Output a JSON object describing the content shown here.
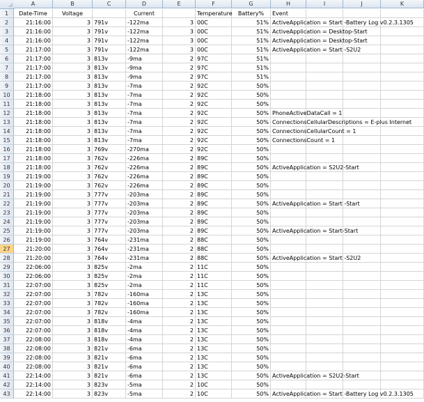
{
  "columns": [
    "A",
    "B",
    "C",
    "D",
    "E",
    "F",
    "G",
    "H",
    "I",
    "J",
    "K"
  ],
  "header": {
    "A": "Date-Time",
    "B": "Voltage",
    "D": "Current",
    "F": "Temperature",
    "G": "Battery%",
    "H": "Event"
  },
  "rows": [
    {
      "A": "21:16:00",
      "B": "3",
      "C": "791v",
      "D": "-122ma",
      "E": "3",
      "F": "00C",
      "G": "51%",
      "H": "ActiveApplication = Start   -Battery Log v0.2.3.1305"
    },
    {
      "A": "21:16:00",
      "B": "3",
      "C": "791v",
      "D": "-122ma",
      "E": "3",
      "F": "00C",
      "G": "51%",
      "H": "ActiveApplication = Desktop-Start"
    },
    {
      "A": "21:16:00",
      "B": "3",
      "C": "791v",
      "D": "-122ma",
      "E": "3",
      "F": "00C",
      "G": "51%",
      "H": "ActiveApplication = Desktop-Start"
    },
    {
      "A": "21:17:00",
      "B": "3",
      "C": "791v",
      "D": "-122ma",
      "E": "3",
      "F": "00C",
      "G": "51%",
      "H": "ActiveApplication = Start   -S2U2"
    },
    {
      "A": "21:17:00",
      "B": "3",
      "C": "813v",
      "D": "-9ma",
      "E": "2",
      "F": "97C",
      "G": "51%",
      "H": ""
    },
    {
      "A": "21:17:00",
      "B": "3",
      "C": "813v",
      "D": "-9ma",
      "E": "2",
      "F": "97C",
      "G": "51%",
      "H": ""
    },
    {
      "A": "21:17:00",
      "B": "3",
      "C": "813v",
      "D": "-9ma",
      "E": "2",
      "F": "97C",
      "G": "51%",
      "H": ""
    },
    {
      "A": "21:17:00",
      "B": "3",
      "C": "813v",
      "D": "-7ma",
      "E": "2",
      "F": "92C",
      "G": "50%",
      "H": ""
    },
    {
      "A": "21:18:00",
      "B": "3",
      "C": "813v",
      "D": "-7ma",
      "E": "2",
      "F": "92C",
      "G": "50%",
      "H": ""
    },
    {
      "A": "21:18:00",
      "B": "3",
      "C": "813v",
      "D": "-7ma",
      "E": "2",
      "F": "92C",
      "G": "50%",
      "H": ""
    },
    {
      "A": "21:18:00",
      "B": "3",
      "C": "813v",
      "D": "-7ma",
      "E": "2",
      "F": "92C",
      "G": "50%",
      "H": "PhoneActiveDataCall = 1"
    },
    {
      "A": "21:18:00",
      "B": "3",
      "C": "813v",
      "D": "-7ma",
      "E": "2",
      "F": "92C",
      "G": "50%",
      "H": "ConnectionsCellularDescriptions = E-plus Internet"
    },
    {
      "A": "21:18:00",
      "B": "3",
      "C": "813v",
      "D": "-7ma",
      "E": "2",
      "F": "92C",
      "G": "50%",
      "H": "ConnectionsCellularCount = 1"
    },
    {
      "A": "21:18:00",
      "B": "3",
      "C": "813v",
      "D": "-7ma",
      "E": "2",
      "F": "92C",
      "G": "50%",
      "H": "ConnectionsCount = 1"
    },
    {
      "A": "21:18:00",
      "B": "3",
      "C": "769v",
      "D": "-270ma",
      "E": "2",
      "F": "92C",
      "G": "50%",
      "H": ""
    },
    {
      "A": "21:18:00",
      "B": "3",
      "C": "762v",
      "D": "-226ma",
      "E": "2",
      "F": "89C",
      "G": "50%",
      "H": ""
    },
    {
      "A": "21:18:00",
      "B": "3",
      "C": "762v",
      "D": "-226ma",
      "E": "2",
      "F": "89C",
      "G": "50%",
      "H": "ActiveApplication = S2U2-Start"
    },
    {
      "A": "21:19:00",
      "B": "3",
      "C": "762v",
      "D": "-226ma",
      "E": "2",
      "F": "89C",
      "G": "50%",
      "H": ""
    },
    {
      "A": "21:19:00",
      "B": "3",
      "C": "762v",
      "D": "-226ma",
      "E": "2",
      "F": "89C",
      "G": "50%",
      "H": ""
    },
    {
      "A": "21:19:00",
      "B": "3",
      "C": "777v",
      "D": "-203ma",
      "E": "2",
      "F": "89C",
      "G": "50%",
      "H": ""
    },
    {
      "A": "21:19:00",
      "B": "3",
      "C": "777v",
      "D": "-203ma",
      "E": "2",
      "F": "89C",
      "G": "50%",
      "H": "ActiveApplication = Start   -Start"
    },
    {
      "A": "21:19:00",
      "B": "3",
      "C": "777v",
      "D": "-203ma",
      "E": "2",
      "F": "89C",
      "G": "50%",
      "H": ""
    },
    {
      "A": "21:19:00",
      "B": "3",
      "C": "777v",
      "D": "-203ma",
      "E": "2",
      "F": "89C",
      "G": "50%",
      "H": ""
    },
    {
      "A": "21:19:00",
      "B": "3",
      "C": "777v",
      "D": "-203ma",
      "E": "2",
      "F": "89C",
      "G": "50%",
      "H": "ActiveApplication = Start-Start"
    },
    {
      "A": "21:19:00",
      "B": "3",
      "C": "764v",
      "D": "-231ma",
      "E": "2",
      "F": "88C",
      "G": "50%",
      "H": ""
    },
    {
      "A": "21:20:00",
      "B": "3",
      "C": "764v",
      "D": "-231ma",
      "E": "2",
      "F": "88C",
      "G": "50%",
      "H": ""
    },
    {
      "A": "21:20:00",
      "B": "3",
      "C": "764v",
      "D": "-231ma",
      "E": "2",
      "F": "88C",
      "G": "50%",
      "H": "ActiveApplication = Start   -S2U2"
    },
    {
      "A": "22:06:00",
      "B": "3",
      "C": "825v",
      "D": "-2ma",
      "E": "2",
      "F": "11C",
      "G": "50%",
      "H": ""
    },
    {
      "A": "22:06:00",
      "B": "3",
      "C": "825v",
      "D": "-2ma",
      "E": "2",
      "F": "11C",
      "G": "50%",
      "H": ""
    },
    {
      "A": "22:07:00",
      "B": "3",
      "C": "825v",
      "D": "-2ma",
      "E": "2",
      "F": "11C",
      "G": "50%",
      "H": ""
    },
    {
      "A": "22:07:00",
      "B": "3",
      "C": "782v",
      "D": "-160ma",
      "E": "2",
      "F": "13C",
      "G": "50%",
      "H": ""
    },
    {
      "A": "22:07:00",
      "B": "3",
      "C": "782v",
      "D": "-160ma",
      "E": "2",
      "F": "13C",
      "G": "50%",
      "H": ""
    },
    {
      "A": "22:07:00",
      "B": "3",
      "C": "782v",
      "D": "-160ma",
      "E": "2",
      "F": "13C",
      "G": "50%",
      "H": ""
    },
    {
      "A": "22:07:00",
      "B": "3",
      "C": "818v",
      "D": "-4ma",
      "E": "2",
      "F": "13C",
      "G": "50%",
      "H": ""
    },
    {
      "A": "22:07:00",
      "B": "3",
      "C": "818v",
      "D": "-4ma",
      "E": "2",
      "F": "13C",
      "G": "50%",
      "H": ""
    },
    {
      "A": "22:08:00",
      "B": "3",
      "C": "818v",
      "D": "-4ma",
      "E": "2",
      "F": "13C",
      "G": "50%",
      "H": ""
    },
    {
      "A": "22:08:00",
      "B": "3",
      "C": "821v",
      "D": "-6ma",
      "E": "2",
      "F": "13C",
      "G": "50%",
      "H": ""
    },
    {
      "A": "22:08:00",
      "B": "3",
      "C": "821v",
      "D": "-6ma",
      "E": "2",
      "F": "13C",
      "G": "50%",
      "H": ""
    },
    {
      "A": "22:08:00",
      "B": "3",
      "C": "821v",
      "D": "-6ma",
      "E": "2",
      "F": "13C",
      "G": "50%",
      "H": ""
    },
    {
      "A": "22:14:00",
      "B": "3",
      "C": "821v",
      "D": "-6ma",
      "E": "2",
      "F": "13C",
      "G": "50%",
      "H": "ActiveApplication = S2U2-Start"
    },
    {
      "A": "22:14:00",
      "B": "3",
      "C": "823v",
      "D": "-5ma",
      "E": "2",
      "F": "10C",
      "G": "50%",
      "H": ""
    },
    {
      "A": "22:14:00",
      "B": "3",
      "C": "823v",
      "D": "-5ma",
      "E": "2",
      "F": "10C",
      "G": "50%",
      "H": "ActiveApplication = Start   -Battery Log v0.2.3.1305"
    }
  ],
  "selected_row": 27
}
